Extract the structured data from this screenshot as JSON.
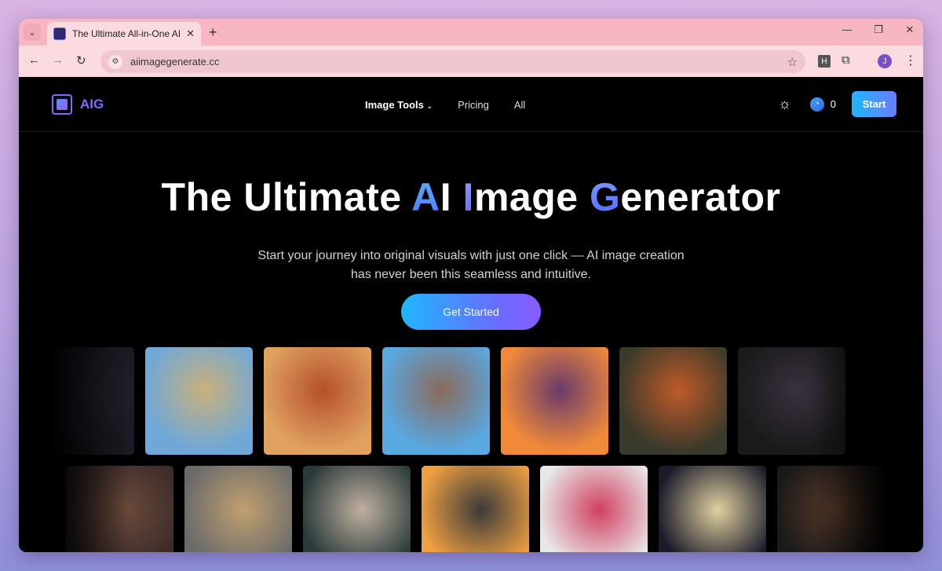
{
  "browser": {
    "tab_title": "The Ultimate All-in-One AI Imag",
    "url": "aiimagegenerate.cc",
    "extension_badge": "H",
    "profile_initial": "J"
  },
  "header": {
    "logo_text": "AIG",
    "nav": [
      {
        "label": "Image Tools"
      },
      {
        "label": "Pricing"
      },
      {
        "label": "All"
      }
    ],
    "credits": "0",
    "start_label": "Start"
  },
  "hero": {
    "title_part1": "The Ultimate ",
    "title_a": "A",
    "title_part2": "I ",
    "title_i": "I",
    "title_part3": "mage ",
    "title_g": "G",
    "title_part4": "enerator",
    "subtitle": "Start your journey into original visuals with just one click — AI image creation has never been this seamless and intuitive.",
    "cta_label": "Get Started"
  },
  "gallery": {
    "row1": [
      {
        "name": "heart-dark",
        "colors": [
          "#1a1a22",
          "#2a2030"
        ]
      },
      {
        "name": "cowgirl-horse",
        "colors": [
          "#6fa8d8",
          "#c9b07a"
        ]
      },
      {
        "name": "autumn-girl",
        "colors": [
          "#e0a060",
          "#b5502a"
        ]
      },
      {
        "name": "anime-street",
        "colors": [
          "#5aa8e0",
          "#8a6a5a"
        ]
      },
      {
        "name": "sunset-street-car",
        "colors": [
          "#f08a3a",
          "#6a3a6a"
        ]
      },
      {
        "name": "cyber-helmet-girl",
        "colors": [
          "#3a3a2a",
          "#c05a2a"
        ]
      },
      {
        "name": "dark-temple",
        "colors": [
          "#1a1a1a",
          "#3a3040"
        ]
      }
    ],
    "row2": [
      {
        "name": "pug",
        "colors": [
          "#3a2a2a",
          "#6a4a3a"
        ]
      },
      {
        "name": "glass-vehicle",
        "colors": [
          "#6a6a6a",
          "#c0a070"
        ]
      },
      {
        "name": "cat-kimono",
        "colors": [
          "#2a3a3a",
          "#c0b0a0"
        ]
      },
      {
        "name": "porsche-sunset",
        "colors": [
          "#f0a040",
          "#3a3a3a"
        ]
      },
      {
        "name": "crane-berries",
        "colors": [
          "#e8e8e8",
          "#d04060"
        ]
      },
      {
        "name": "hooded-woman",
        "colors": [
          "#1a1a2a",
          "#e0d0a0"
        ]
      },
      {
        "name": "dark-autumn",
        "colors": [
          "#1a1a1a",
          "#5a3a2a"
        ]
      }
    ]
  }
}
